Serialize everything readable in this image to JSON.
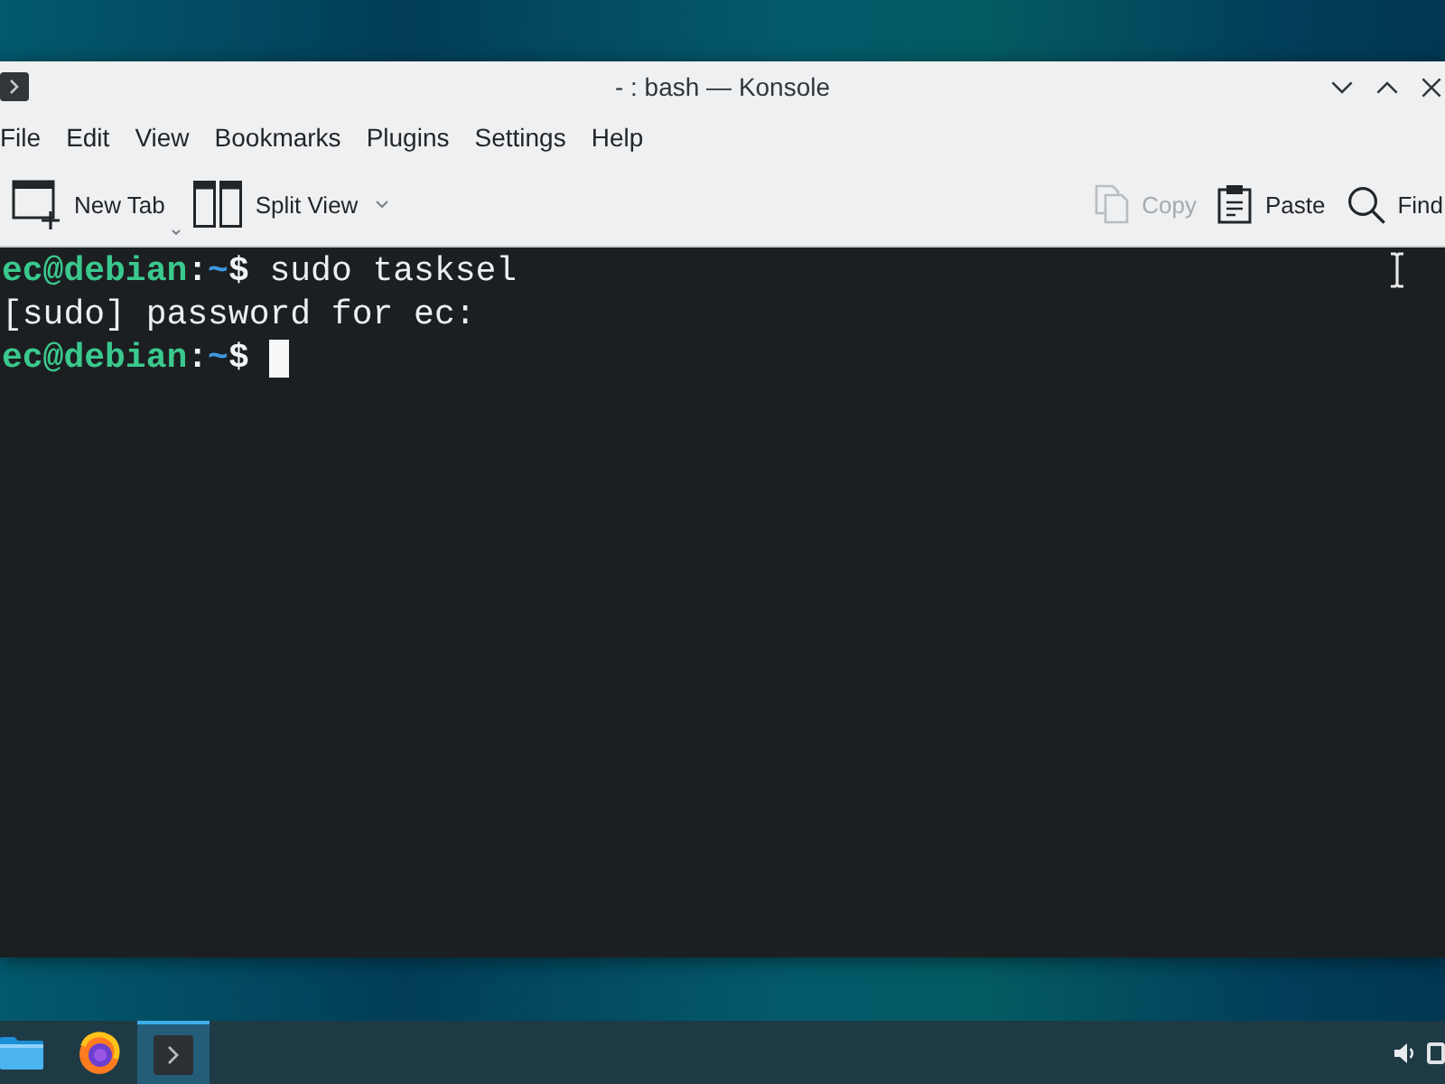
{
  "window": {
    "title": "- : bash — Konsole"
  },
  "menu": [
    "File",
    "Edit",
    "View",
    "Bookmarks",
    "Plugins",
    "Settings",
    "Help"
  ],
  "toolbar": {
    "left": [
      {
        "kind": "new_tab",
        "label": "New Tab",
        "disabled": false,
        "dropdown": true
      },
      {
        "kind": "split_view",
        "label": "Split View",
        "disabled": false,
        "dropdown": true
      }
    ],
    "right": [
      {
        "kind": "copy",
        "label": "Copy",
        "disabled": true,
        "dropdown": false
      },
      {
        "kind": "paste",
        "label": "Paste",
        "disabled": false,
        "dropdown": false
      },
      {
        "kind": "find",
        "label": "Find",
        "disabled": false,
        "dropdown": false
      }
    ]
  },
  "terminal": {
    "lines": [
      {
        "kind": "prompt",
        "user_host": "ec@debian",
        "separator": ":",
        "path": "~",
        "symbol": "$",
        "command": "sudo tasksel",
        "cursor": false
      },
      {
        "kind": "output",
        "text": "[sudo] password for ec:",
        "cursor": false
      },
      {
        "kind": "prompt",
        "user_host": "ec@debian",
        "separator": ":",
        "path": "~",
        "symbol": "$",
        "cursor": true
      }
    ]
  },
  "taskbar": {
    "items": [
      {
        "kind": "folder",
        "active": false
      },
      {
        "kind": "browser",
        "active": false
      },
      {
        "kind": "terminal",
        "active": true
      }
    ]
  }
}
